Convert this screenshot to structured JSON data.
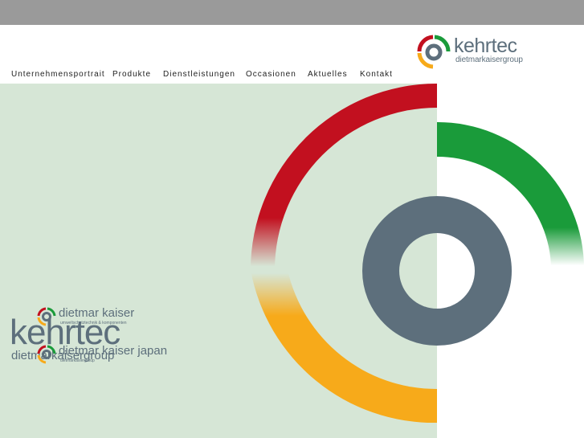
{
  "header": {
    "logo_brand": "kehrtec",
    "logo_sub": "dietmarkaisergroup"
  },
  "nav": {
    "items": [
      {
        "label": "Unternehmensportrait"
      },
      {
        "label": "Produkte"
      },
      {
        "label": "Dienstleistungen"
      },
      {
        "label": "Occasionen"
      },
      {
        "label": "Aktuelles"
      },
      {
        "label": "Kontakt"
      }
    ]
  },
  "hero": {
    "brand": "kehrtec",
    "sub": "dietmarkaisergroup"
  },
  "partners": [
    {
      "name": "dietmar kaiser",
      "tagline": "umweltschutztechnik & komponenten"
    },
    {
      "name": "dietmar kaiser japan",
      "tagline": "dietmarkaisergroup"
    }
  ],
  "colors": {
    "red": "#c2101f",
    "green": "#1a9b3a",
    "orange": "#f7aa1a",
    "slate": "#5d6f7c",
    "panel": "#d6e6d6",
    "topbar": "#9a9a9a"
  },
  "icons": {
    "logo_mark": "kehrtec-ring-logo-icon"
  }
}
